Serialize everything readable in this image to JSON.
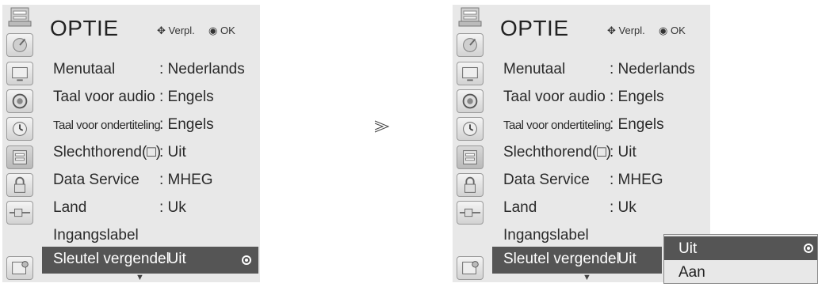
{
  "menu": {
    "title": "OPTIE",
    "hint_move": "Verpl.",
    "hint_ok": "OK",
    "items": [
      {
        "label": "Menutaal",
        "value": ": Nederlands",
        "narrow": false
      },
      {
        "label": "Taal voor audio",
        "value": ": Engels",
        "narrow": false
      },
      {
        "label": "Taal voor ondertiteling",
        "value": ": Engels",
        "narrow": true
      },
      {
        "label": "Slechthorend(□)",
        "value": ": Uit",
        "narrow": false
      },
      {
        "label": "Data Service",
        "value": ": MHEG",
        "narrow": false
      },
      {
        "label": "Land",
        "value": ": Uk",
        "narrow": false
      },
      {
        "label": "Ingangslabel",
        "value": "",
        "narrow": false
      },
      {
        "label": "Sleutel vergendel",
        "value": ": Uit",
        "narrow": false,
        "selected": true
      }
    ],
    "icons": [
      "satellite-dish-icon",
      "tv-screen-icon",
      "speaker-icon",
      "clock-icon",
      "option-folder-icon",
      "lock-icon",
      "cable-plug-icon",
      "screen-settings-icon"
    ]
  },
  "transition_symbol": "≫",
  "dropdown": {
    "options": [
      "Uit",
      "Aan"
    ],
    "selected": "Uit"
  }
}
